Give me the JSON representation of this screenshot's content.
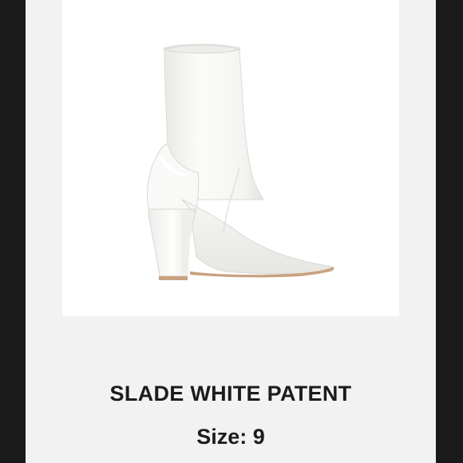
{
  "product": {
    "name": "SLADE WHITE PATENT",
    "size_label": "Size:",
    "size_value": "9"
  },
  "image": {
    "subject": "white-patent-sock-boot-icon"
  },
  "colors": {
    "outer_background": "#1a1a1a",
    "panel_background": "#f2f2f2",
    "photo_background": "#ffffff",
    "text": "#1c1c1c",
    "boot_white": "#f7f7f5",
    "heel_sole_tan": "#c9a27e"
  }
}
